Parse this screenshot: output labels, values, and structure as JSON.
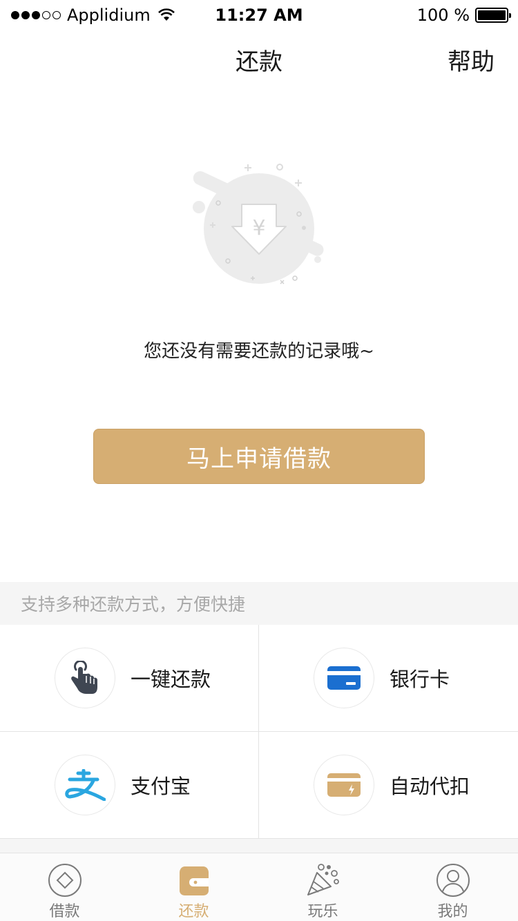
{
  "status_bar": {
    "carrier": "Applidium",
    "time": "11:27 AM",
    "battery": "100 %",
    "battery_level": 1.0
  },
  "nav": {
    "title": "还款",
    "help": "帮助"
  },
  "empty_state": {
    "icon": "yen-download-icon",
    "message": "您还没有需要还款的记录哦~"
  },
  "apply_button": {
    "label": "马上申请借款"
  },
  "methods_section": {
    "header": "支持多种还款方式，方便快捷",
    "items": [
      {
        "label": "一键还款",
        "icon": "tap-hand-icon"
      },
      {
        "label": "银行卡",
        "icon": "bank-card-icon"
      },
      {
        "label": "支付宝",
        "icon": "alipay-icon"
      },
      {
        "label": "自动代扣",
        "icon": "auto-debit-card-icon"
      }
    ]
  },
  "tabs": [
    {
      "label": "借款",
      "icon": "diamond-circle-icon",
      "active": false
    },
    {
      "label": "还款",
      "icon": "wallet-icon",
      "active": true
    },
    {
      "label": "玩乐",
      "icon": "party-icon",
      "active": false
    },
    {
      "label": "我的",
      "icon": "user-icon",
      "active": false
    }
  ],
  "colors": {
    "accent": "#d6ae73",
    "bank_blue": "#1b6fd0",
    "alipay_blue": "#2aa6e0",
    "tab_inactive": "#7a7a7a"
  }
}
